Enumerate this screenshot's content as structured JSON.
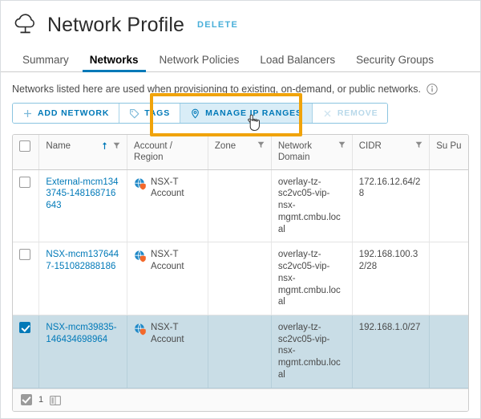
{
  "header": {
    "title": "Network Profile",
    "delete_label": "DELETE",
    "cloud_icon": "cloud-network-icon"
  },
  "tabs": [
    {
      "label": "Summary",
      "active": false
    },
    {
      "label": "Networks",
      "active": true
    },
    {
      "label": "Network Policies",
      "active": false
    },
    {
      "label": "Load Balancers",
      "active": false
    },
    {
      "label": "Security Groups",
      "active": false
    }
  ],
  "description": {
    "text": "Networks listed here are used when provisioning to existing, on-demand, or public networks.",
    "info_icon": "info-circle-icon"
  },
  "toolbar": {
    "buttons": [
      {
        "label": "ADD NETWORK",
        "icon": "plus-icon",
        "state": "normal"
      },
      {
        "label": "TAGS",
        "icon": "tag-icon",
        "state": "normal"
      },
      {
        "label": "MANAGE IP RANGES",
        "icon": "map-pin-icon",
        "state": "hovered"
      },
      {
        "label": "REMOVE",
        "icon": "close-x-icon",
        "state": "disabled"
      }
    ]
  },
  "annotation": {
    "color": "#f0a30a",
    "target": "MANAGE IP RANGES"
  },
  "table": {
    "columns": [
      {
        "label": "Name",
        "sorted": "asc",
        "filter": true
      },
      {
        "label": "Account / Region",
        "sorted": "none",
        "filter": false
      },
      {
        "label": "Zone",
        "sorted": "none",
        "filter": true
      },
      {
        "label": "Network Domain",
        "sorted": "none",
        "filter": true
      },
      {
        "label": "CIDR",
        "sorted": "none",
        "filter": true
      },
      {
        "label": "Su Pu",
        "sorted": "none",
        "filter": false
      }
    ],
    "rows": [
      {
        "selected": false,
        "name": "External-mcm1343745-148168716643",
        "account": "NSX-T Account",
        "account_icon": "nsx-account-icon",
        "zone": "",
        "network_domain": "overlay-tz-sc2vc05-vip-nsx-mgmt.cmbu.local",
        "cidr": "172.16.12.64/28",
        "supports_public": ""
      },
      {
        "selected": false,
        "name": "NSX-mcm1376447-151082888186",
        "account": "NSX-T Account",
        "account_icon": "nsx-account-icon",
        "zone": "",
        "network_domain": "overlay-tz-sc2vc05-vip-nsx-mgmt.cmbu.local",
        "cidr": "192.168.100.32/28",
        "supports_public": ""
      },
      {
        "selected": true,
        "name": "NSX-mcm39835-146434698964",
        "account": "NSX-T Account",
        "account_icon": "nsx-account-icon",
        "zone": "",
        "network_domain": "overlay-tz-sc2vc05-vip-nsx-mgmt.cmbu.local",
        "cidr": "192.168.1.0/27",
        "supports_public": ""
      }
    ],
    "footer": {
      "selected_count": "1",
      "columns_icon": "column-layout-icon"
    }
  },
  "colors": {
    "accent": "#0079b8",
    "link": "#49afd9",
    "annotation": "#f0a30a",
    "selected_row": "#c9dde6"
  }
}
